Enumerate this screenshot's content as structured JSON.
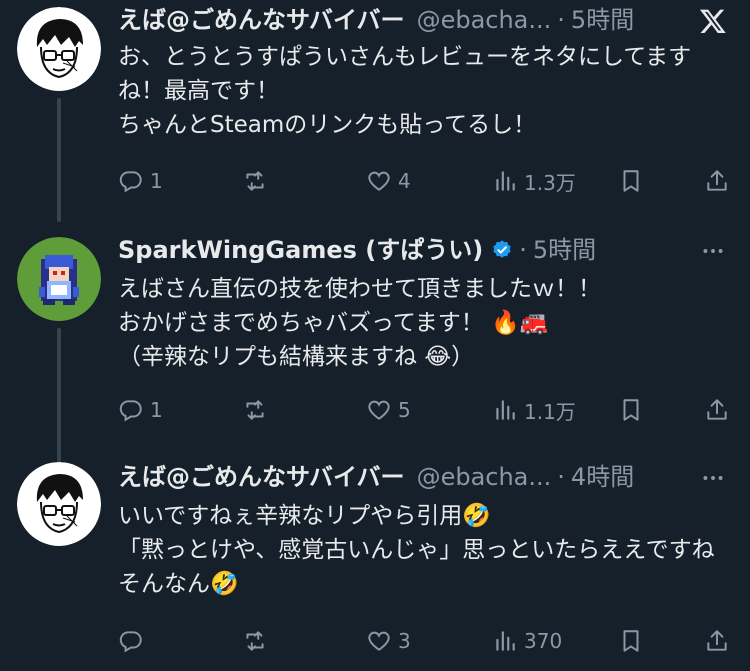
{
  "tweets": [
    {
      "name": "えば@ごめんなサバイバー",
      "handle": "@ebacha...",
      "dot": "·",
      "time": "5時間",
      "text": "お、とうとうすぱういさんもレビューをネタにしてますね！最高です！\nちゃんとSteamのリンクも貼ってるし！",
      "replies": "1",
      "retweets": "",
      "likes": "4",
      "views": "1.3万"
    },
    {
      "name": "SparkWingGames (すぱうい)",
      "handle": "",
      "dot": "·",
      "time": "5時間",
      "verified": true,
      "text": "えばさん直伝の技を使わせて頂きましたｗ！！\nおかげさまでめちゃバズってます！ 🔥🚒\n（辛辣なリプも結構来ますね 😂）",
      "replies": "1",
      "retweets": "",
      "likes": "5",
      "views": "1.1万"
    },
    {
      "name": "えば@ごめんなサバイバー",
      "handle": "@ebacha...",
      "dot": "·",
      "time": "4時間",
      "text": "いいですねぇ辛辣なリプやら引用🤣\n「黙っとけや、感覚古いんじゃ」思っといたらええですねそんなん🤣",
      "replies": "",
      "retweets": "",
      "likes": "3",
      "views": "370"
    }
  ],
  "icons": {
    "corner_first": "x-logo-icon",
    "corner_other": "more-icon",
    "reply": "reply-icon",
    "retweet": "retweet-icon",
    "like": "heart-icon",
    "views": "views-icon",
    "bookmark": "bookmark-icon",
    "share": "share-icon"
  },
  "colors": {
    "background": "#15202b",
    "text": "#e7e9ea",
    "secondary": "#8b98a5",
    "verified": "#1d9bf0"
  }
}
